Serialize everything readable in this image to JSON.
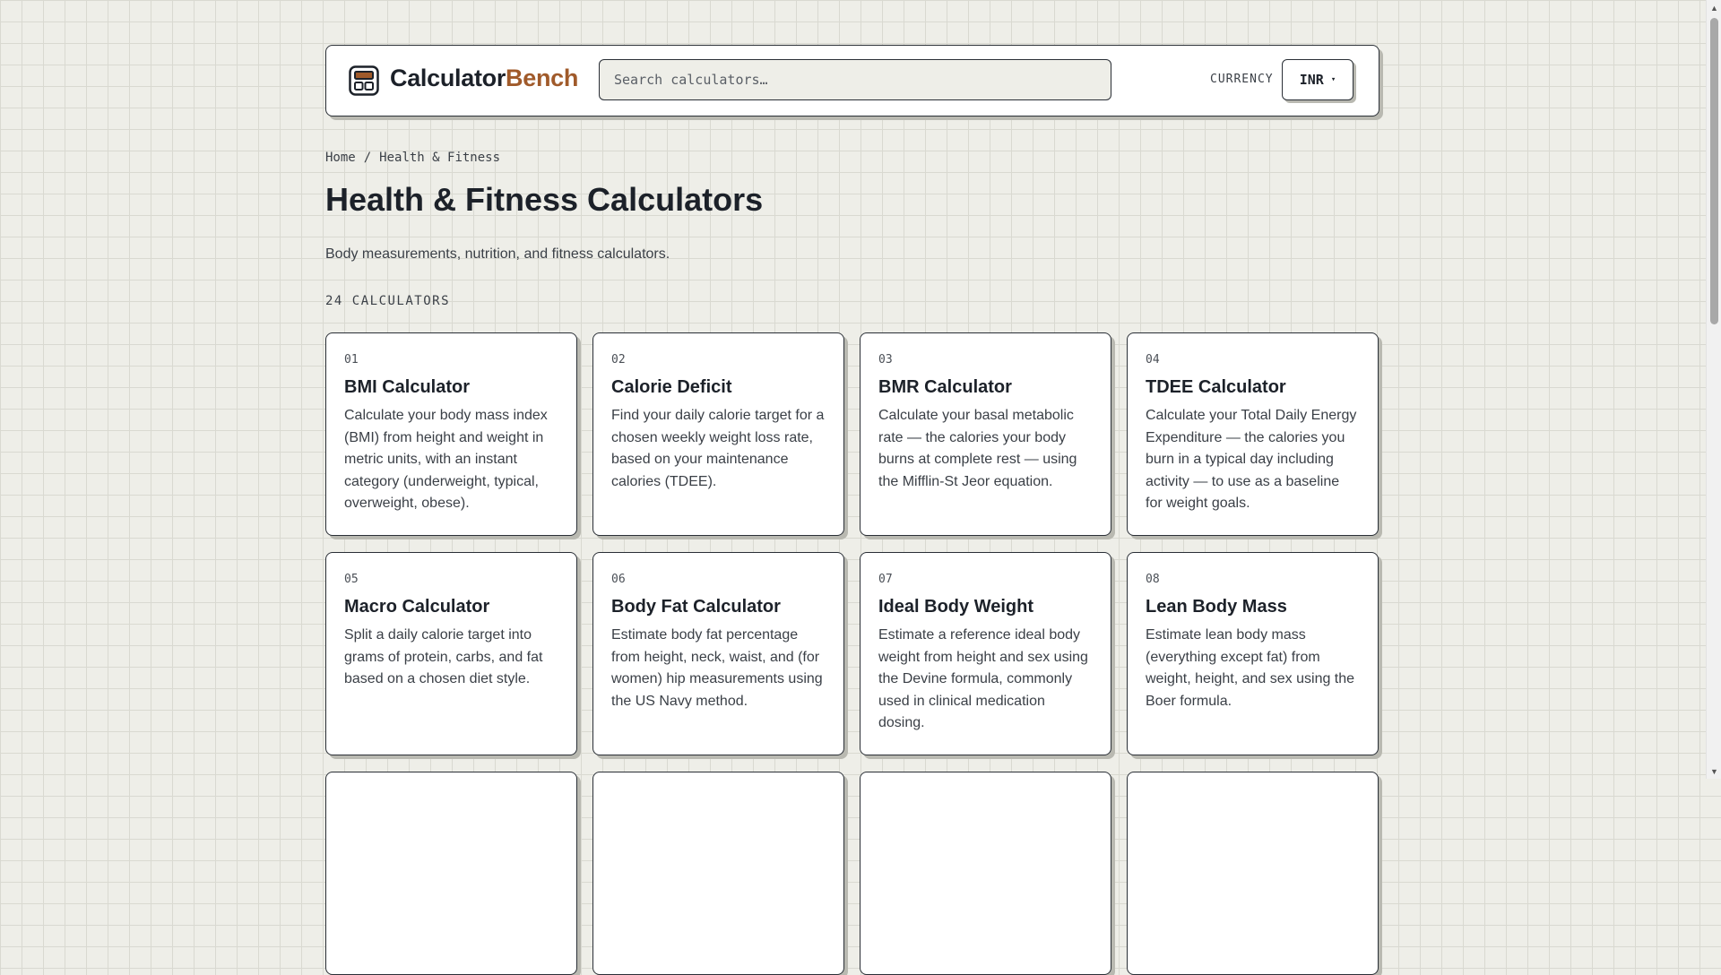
{
  "brand": {
    "name_part1": "Calculator",
    "name_part2": "Bench",
    "accent_color": "#a05a2a"
  },
  "search": {
    "placeholder": "Search calculators…",
    "value": ""
  },
  "currency": {
    "label": "CURRENCY",
    "selected": "INR",
    "caret": "▾"
  },
  "breadcrumb": {
    "home": "Home",
    "separator": "/",
    "current": "Health & Fitness"
  },
  "page": {
    "title": "Health & Fitness Calculators",
    "description": "Body measurements, nutrition, and fitness calculators.",
    "count_label": "24 CALCULATORS"
  },
  "cards": [
    {
      "num": "01",
      "title": "BMI Calculator",
      "desc": "Calculate your body mass index (BMI) from height and weight in metric units, with an instant category (underweight, typical, overweight, obese)."
    },
    {
      "num": "02",
      "title": "Calorie Deficit",
      "desc": "Find your daily calorie target for a chosen weekly weight loss rate, based on your maintenance calories (TDEE)."
    },
    {
      "num": "03",
      "title": "BMR Calculator",
      "desc": "Calculate your basal metabolic rate — the calories your body burns at complete rest — using the Mifflin-St Jeor equation."
    },
    {
      "num": "04",
      "title": "TDEE Calculator",
      "desc": "Calculate your Total Daily Energy Expenditure — the calories you burn in a typical day including activity — to use as a baseline for weight goals."
    },
    {
      "num": "05",
      "title": "Macro Calculator",
      "desc": "Split a daily calorie target into grams of protein, carbs, and fat based on a chosen diet style."
    },
    {
      "num": "06",
      "title": "Body Fat Calculator",
      "desc": "Estimate body fat percentage from height, neck, waist, and (for women) hip measurements using the US Navy method."
    },
    {
      "num": "07",
      "title": "Ideal Body Weight",
      "desc": "Estimate a reference ideal body weight from height and sex using the Devine formula, commonly used in clinical medication dosing."
    },
    {
      "num": "08",
      "title": "Lean Body Mass",
      "desc": "Estimate lean body mass (everything except fat) from weight, height, and sex using the Boer formula."
    }
  ]
}
